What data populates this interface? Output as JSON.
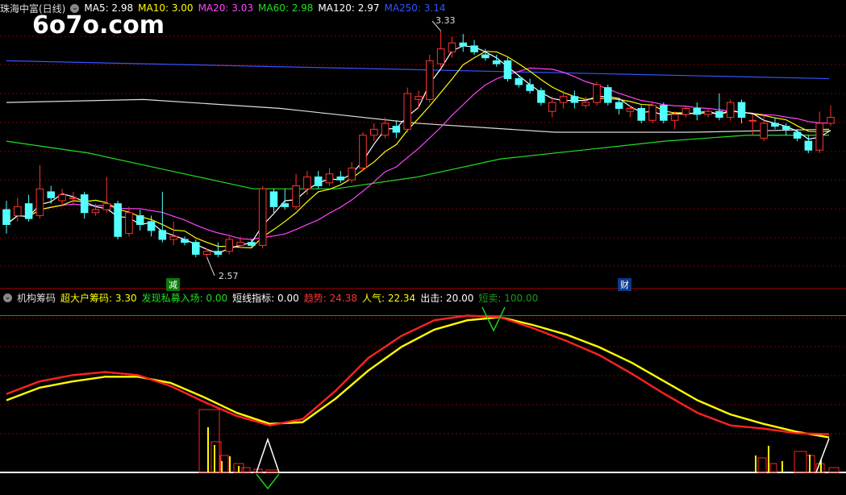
{
  "watermark": "6o7o.com",
  "main_header": {
    "title": "珠海中富(日线)",
    "items": [
      {
        "label": "MA5: 2.98",
        "color": "#ffffff"
      },
      {
        "label": "MA10: 3.00",
        "color": "#ffff00"
      },
      {
        "label": "MA20: 3.03",
        "color": "#ff44ff"
      },
      {
        "label": "MA60: 2.98",
        "color": "#22dd22"
      },
      {
        "label": "MA120: 2.97",
        "color": "#ffffff"
      },
      {
        "label": "MA250: 3.14",
        "color": "#3355ff"
      }
    ]
  },
  "indicator_header": {
    "title": "机构筹码",
    "items": [
      {
        "label": "超大户筹码: 3.30",
        "color": "#ffff00"
      },
      {
        "label": "发现私募入场: 0.00",
        "color": "#22dd22"
      },
      {
        "label": "短线指标: 0.00",
        "color": "#ffffff"
      },
      {
        "label": "趋势: 24.38",
        "color": "#ff3333"
      },
      {
        "label": "人气: 22.34",
        "color": "#ffff00"
      },
      {
        "label": "出击: 20.00",
        "color": "#ffffff"
      },
      {
        "label": "短卖: 100.00",
        "color": "#1a9a1a"
      }
    ]
  },
  "annotations": {
    "high_label": "3.33",
    "low_label": "2.57",
    "marker_left": "减",
    "marker_right": "财"
  },
  "colors": {
    "up": "#ff3232",
    "down": "#54ffff",
    "ma5": "#ffffff",
    "ma10": "#ffff00",
    "ma20": "#ff44ff",
    "ma60": "#22dd22",
    "ma120": "#dddddd",
    "ma250": "#3355ff",
    "grid": "#7a0000",
    "trend": "#ff2222",
    "popularity": "#ffff00"
  },
  "chart_data": {
    "type": "candlestick",
    "ylim": [
      2.5,
      3.38
    ],
    "candles": [
      [
        2.73,
        2.68,
        2.76,
        2.65
      ],
      [
        2.71,
        2.74,
        2.77,
        2.69
      ],
      [
        2.75,
        2.7,
        2.78,
        2.69
      ],
      [
        2.71,
        2.8,
        2.88,
        2.7
      ],
      [
        2.79,
        2.77,
        2.81,
        2.75
      ],
      [
        2.76,
        2.78,
        2.8,
        2.74
      ],
      [
        2.77,
        2.77,
        2.79,
        2.75
      ],
      [
        2.78,
        2.72,
        2.79,
        2.7
      ],
      [
        2.72,
        2.73,
        2.75,
        2.71
      ],
      [
        2.73,
        2.75,
        2.84,
        2.72
      ],
      [
        2.75,
        2.64,
        2.76,
        2.63
      ],
      [
        2.65,
        2.72,
        2.74,
        2.64
      ],
      [
        2.71,
        2.68,
        2.73,
        2.66
      ],
      [
        2.69,
        2.66,
        2.71,
        2.64
      ],
      [
        2.66,
        2.63,
        2.79,
        2.62
      ],
      [
        2.63,
        2.64,
        2.69,
        2.61
      ],
      [
        2.63,
        2.62,
        2.64,
        2.61
      ],
      [
        2.62,
        2.58,
        2.63,
        2.57
      ],
      [
        2.58,
        2.59,
        2.6,
        2.57
      ],
      [
        2.59,
        2.58,
        2.62,
        2.57
      ],
      [
        2.59,
        2.63,
        2.64,
        2.58
      ],
      [
        2.61,
        2.62,
        2.64,
        2.6
      ],
      [
        2.62,
        2.61,
        2.63,
        2.6
      ],
      [
        2.61,
        2.8,
        2.81,
        2.6
      ],
      [
        2.79,
        2.74,
        2.8,
        2.72
      ],
      [
        2.75,
        2.74,
        2.8,
        2.73
      ],
      [
        2.74,
        2.81,
        2.85,
        2.73
      ],
      [
        2.8,
        2.84,
        2.86,
        2.78
      ],
      [
        2.84,
        2.81,
        2.86,
        2.8
      ],
      [
        2.82,
        2.85,
        2.87,
        2.81
      ],
      [
        2.84,
        2.83,
        2.86,
        2.82
      ],
      [
        2.83,
        2.87,
        2.89,
        2.82
      ],
      [
        2.87,
        2.98,
        2.99,
        2.86
      ],
      [
        2.98,
        3.0,
        3.02,
        2.96
      ],
      [
        2.98,
        3.02,
        3.04,
        2.97
      ],
      [
        3.01,
        2.99,
        3.03,
        2.97
      ],
      [
        3.0,
        3.12,
        3.14,
        2.99
      ],
      [
        3.1,
        3.11,
        3.13,
        3.07
      ],
      [
        3.1,
        3.23,
        3.25,
        3.09
      ],
      [
        3.22,
        3.27,
        3.33,
        3.21
      ],
      [
        3.26,
        3.29,
        3.31,
        3.24
      ],
      [
        3.29,
        3.28,
        3.32,
        3.26
      ],
      [
        3.28,
        3.26,
        3.3,
        3.25
      ],
      [
        3.25,
        3.24,
        3.27,
        3.23
      ],
      [
        3.23,
        3.22,
        3.25,
        3.21
      ],
      [
        3.23,
        3.17,
        3.24,
        3.16
      ],
      [
        3.17,
        3.15,
        3.18,
        3.14
      ],
      [
        3.15,
        3.13,
        3.17,
        3.12
      ],
      [
        3.13,
        3.09,
        3.14,
        3.08
      ],
      [
        3.06,
        3.09,
        3.11,
        3.04
      ],
      [
        3.09,
        3.11,
        3.13,
        3.07
      ],
      [
        3.11,
        3.09,
        3.13,
        3.07
      ],
      [
        3.08,
        3.09,
        3.11,
        3.07
      ],
      [
        3.09,
        3.15,
        3.16,
        3.08
      ],
      [
        3.14,
        3.09,
        3.15,
        3.08
      ],
      [
        3.09,
        3.07,
        3.1,
        3.05
      ],
      [
        3.06,
        3.07,
        3.08,
        3.04
      ],
      [
        3.07,
        3.03,
        3.08,
        3.02
      ],
      [
        3.03,
        3.08,
        3.09,
        3.02
      ],
      [
        3.08,
        3.03,
        3.09,
        3.02
      ],
      [
        3.03,
        3.05,
        3.06,
        3.0
      ],
      [
        3.05,
        3.07,
        3.08,
        3.04
      ],
      [
        3.07,
        3.05,
        3.09,
        3.03
      ],
      [
        3.05,
        3.06,
        3.07,
        3.04
      ],
      [
        3.06,
        3.04,
        3.12,
        3.03
      ],
      [
        3.04,
        3.09,
        3.1,
        3.03
      ],
      [
        3.09,
        3.04,
        3.1,
        3.02
      ],
      [
        3.03,
        3.03,
        3.05,
        2.98
      ],
      [
        2.97,
        3.02,
        3.05,
        2.96
      ],
      [
        3.02,
        3.01,
        3.04,
        3.0
      ],
      [
        3.01,
        3.0,
        3.02,
        2.98
      ],
      [
        2.99,
        2.97,
        3.0,
        2.96
      ],
      [
        2.96,
        2.93,
        2.98,
        2.92
      ],
      [
        2.93,
        3.02,
        3.06,
        2.92
      ],
      [
        3.02,
        3.04,
        3.08,
        3.01
      ]
    ],
    "ma_lines": {
      "ma250": [
        3.23,
        3.17
      ],
      "ma120": [
        3.09,
        3.1,
        3.07,
        3.02,
        2.99,
        2.99,
        3.0
      ],
      "ma60": [
        2.96,
        2.92,
        2.86,
        2.8,
        2.8,
        2.84,
        2.9,
        2.93,
        2.96,
        2.98,
        2.98
      ]
    },
    "indicator": {
      "ylim": [
        0,
        110
      ],
      "trend": [
        50,
        58,
        62,
        64,
        62,
        55,
        45,
        36,
        30,
        34,
        52,
        73,
        87,
        97,
        100,
        99,
        92,
        84,
        75,
        63,
        50,
        38,
        30,
        28,
        25,
        24.38
      ],
      "popularity": [
        46,
        54,
        58,
        61,
        61,
        57,
        48,
        38,
        31,
        32,
        47,
        65,
        80,
        91,
        97,
        99,
        94,
        88,
        80,
        70,
        58,
        46,
        37,
        31,
        26,
        22.34
      ]
    }
  }
}
